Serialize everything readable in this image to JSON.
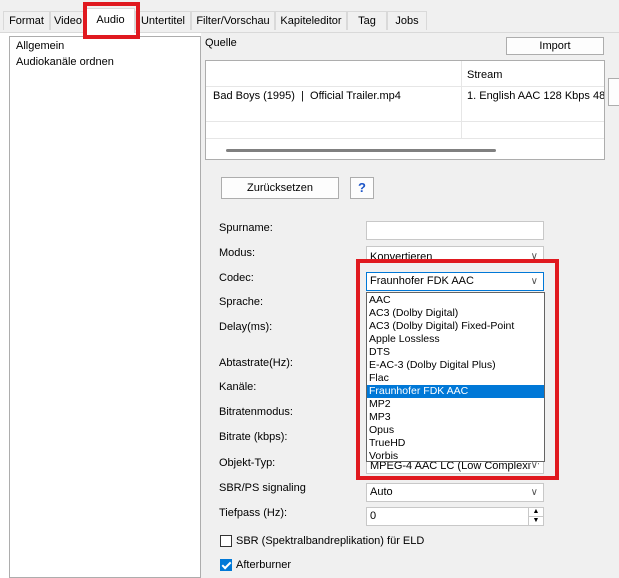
{
  "tabs": [
    {
      "label": "Format"
    },
    {
      "label": "Video"
    },
    {
      "label": "Audio"
    },
    {
      "label": "Untertitel"
    },
    {
      "label": "Filter/Vorschau"
    },
    {
      "label": "Kapiteleditor"
    },
    {
      "label": "Tag"
    },
    {
      "label": "Jobs"
    }
  ],
  "sidebar": {
    "items": [
      {
        "label": "Allgemein"
      },
      {
        "label": "Audiokanäle ordnen"
      }
    ]
  },
  "source": {
    "heading": "Quelle",
    "import_label": "Import",
    "stream_header": "Stream",
    "file_name": "Bad Boys (1995)  |  Official Trailer.mp4",
    "stream_value": "1. English AAC  128 Kbps 48("
  },
  "actions": {
    "reset_label": "Zurücksetzen",
    "help_label": "?"
  },
  "form": {
    "spurname_label": "Spurname:",
    "spurname_value": "",
    "modus_label": "Modus:",
    "modus_value": "Konvertieren",
    "codec_label": "Codec:",
    "codec_value": "Fraunhofer FDK AAC",
    "sprache_label": "Sprache:",
    "delay_label": "Delay(ms):",
    "abtastrate_label": "Abtastrate(Hz):",
    "kanaele_label": "Kanäle:",
    "bitratenmodus_label": "Bitratenmodus:",
    "bitrate_label": "Bitrate (kbps):",
    "objekttyp_label": "Objekt-Typ:",
    "objekttyp_value": "MPEG-4 AAC LC (Low Complexity",
    "sbrps_label": "SBR/PS signaling",
    "sbrps_value": "Auto",
    "tiefpass_label": "Tiefpass (Hz):",
    "tiefpass_value": "0",
    "sbr_eld_label": "SBR (Spektralbandreplikation) für ELD",
    "afterburner_label": "Afterburner"
  },
  "codec_options": [
    {
      "label": "AAC"
    },
    {
      "label": "AC3 (Dolby Digital)"
    },
    {
      "label": "AC3 (Dolby Digital) Fixed-Point"
    },
    {
      "label": "Apple Lossless"
    },
    {
      "label": "DTS"
    },
    {
      "label": "E-AC-3 (Dolby Digital Plus)"
    },
    {
      "label": "Flac"
    },
    {
      "label": "Fraunhofer FDK AAC"
    },
    {
      "label": "MP2"
    },
    {
      "label": "MP3"
    },
    {
      "label": "Opus"
    },
    {
      "label": "TrueHD"
    },
    {
      "label": "Vorbis"
    }
  ],
  "checkboxes": {
    "sbr_eld_checked": false,
    "afterburner_checked": true
  },
  "colors": {
    "selection": "#0078d7",
    "highlight_frame": "#e0191f"
  }
}
